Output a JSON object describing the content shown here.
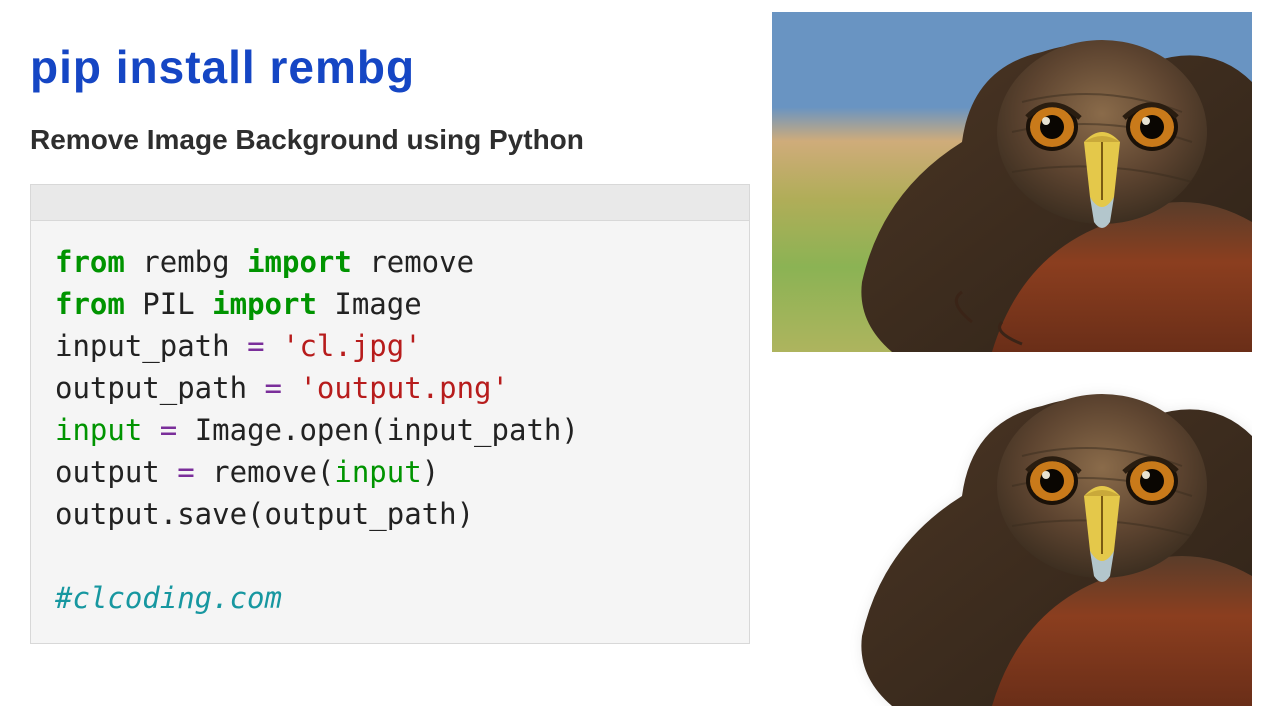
{
  "title": "pip install rembg",
  "subtitle": "Remove Image Background using Python",
  "code": {
    "l1_from": "from",
    "l1_mod": " rembg ",
    "l1_imp": "import",
    "l1_name": " remove",
    "l2_from": "from",
    "l2_mod": " PIL ",
    "l2_imp": "import",
    "l2_name": " Image",
    "l3_a": "input_path ",
    "l3_eq": "=",
    "l3_b": " ",
    "l3_str": "'cl.jpg'",
    "l4_a": "output_path ",
    "l4_eq": "=",
    "l4_b": " ",
    "l4_str": "'output.png'",
    "l5_lhs": "input",
    "l5_sp": " ",
    "l5_eq": "=",
    "l5_rhs": " Image.open(input_path)",
    "l6_a": "output ",
    "l6_eq": "=",
    "l6_b": " remove(",
    "l6_arg": "input",
    "l6_c": ")",
    "l7": "output.save(output_path)",
    "comment": "#clcoding.com"
  },
  "images": {
    "original_label": "original-bird-image",
    "output_label": "background-removed-bird-image"
  }
}
